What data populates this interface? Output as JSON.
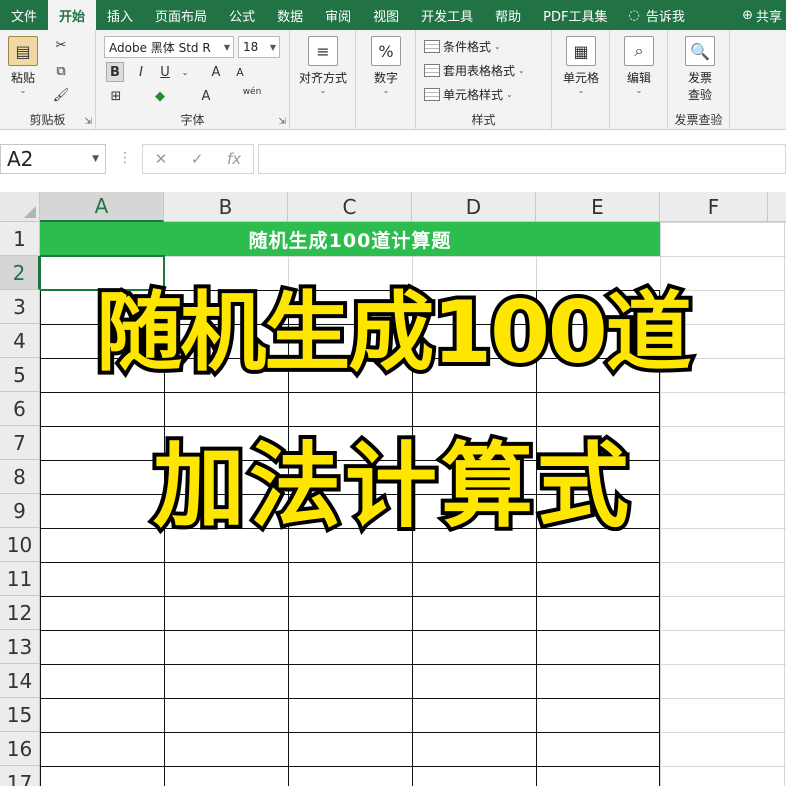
{
  "menu": {
    "tabs": [
      "文件",
      "开始",
      "插入",
      "页面布局",
      "公式",
      "数据",
      "审阅",
      "视图",
      "开发工具",
      "帮助",
      "PDF工具集"
    ],
    "tell_me": "告诉我",
    "share": "共享"
  },
  "ribbon": {
    "clipboard": {
      "paste": "粘贴",
      "label": "剪贴板"
    },
    "font": {
      "name": "Adobe 黑体 Std R",
      "size": "18",
      "bold": "B",
      "italic": "I",
      "underline": "U",
      "grow": "A",
      "shrink": "A",
      "phonetic": "wén",
      "fill_a": "A",
      "label": "字体"
    },
    "alignment": {
      "label": "对齐方式"
    },
    "number": {
      "icon_text": "%",
      "label": "数字"
    },
    "styles": {
      "conditional": "条件格式",
      "table": "套用表格格式",
      "cell_styles": "单元格样式",
      "label": "样式"
    },
    "cells": {
      "label": "单元格"
    },
    "editing": {
      "label": "编辑"
    },
    "invoice": {
      "btn_line1": "发票",
      "btn_line2": "查验",
      "label": "发票查验"
    }
  },
  "formula_bar": {
    "name_box": "A2",
    "cancel": "✕",
    "enter": "✓",
    "fx": "fx",
    "formula": ""
  },
  "sheet": {
    "columns": [
      "A",
      "B",
      "C",
      "D",
      "E",
      "F"
    ],
    "rows": [
      "1",
      "2",
      "3",
      "4",
      "5",
      "6",
      "7",
      "8",
      "9",
      "10",
      "11",
      "12",
      "13",
      "14",
      "15",
      "16",
      "17"
    ],
    "title_cell": "随机生成100道计算题",
    "active_cell": "A2"
  },
  "overlay": {
    "line1": "随机生成100道",
    "line2": "加法计算式",
    "fill_color": "#ffe600",
    "stroke_color": "#000000"
  },
  "colors": {
    "excel_green": "#217346",
    "title_fill": "#2dbd4f"
  }
}
